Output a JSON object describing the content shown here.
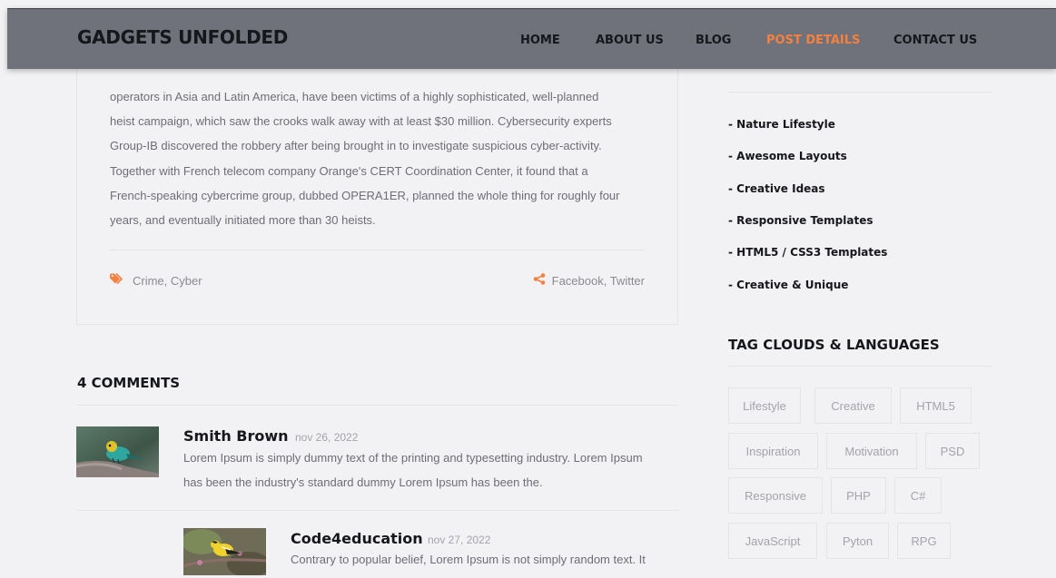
{
  "header": {
    "brand": "GADGETS UNFOLDED",
    "nav": [
      {
        "label": "HOME",
        "active": false
      },
      {
        "label": "ABOUT US",
        "active": false
      },
      {
        "label": "BLOG",
        "active": false
      },
      {
        "label": "POST DETAILS",
        "active": true
      },
      {
        "label": "CONTACT US",
        "active": false
      }
    ]
  },
  "post": {
    "lines": [
      "operators in Asia and Latin America, have been victims of a highly sophisticated, well-planned",
      "heist campaign, which saw the crooks walk away with at least $30 million. Cybersecurity experts",
      "Group-IB discovered the robbery after being brought in to investigate suspicious cyber-activity.",
      "Together with French telecom company Orange's CERT Coordination Center, it found that a",
      "French-speaking cybercrime group, dubbed OPERA1ER, planned the whole thing for roughly four",
      "years, and eventually initiated more than 30 heists."
    ],
    "tags": "Crime, Cyber",
    "tags_icon": "tag-icon",
    "share": "Facebook, Twitter",
    "share_icon": "share-icon"
  },
  "comments": {
    "title": "4 COMMENTS",
    "items": [
      {
        "name": "Smith Brown",
        "date": "nov 26, 2022",
        "text_lines": [
          "Lorem Ipsum is simply dummy text of the printing and typesetting industry. Lorem Ipsum",
          "has been the industry's standard dummy Lorem Ipsum has been the."
        ]
      },
      {
        "name": "Code4education",
        "date": "nov 27, 2022",
        "text_lines": [
          "Contrary to popular belief, Lorem Ipsum is not simply random text. It"
        ]
      }
    ]
  },
  "sidebar": {
    "categories": [
      "- Nature Lifestyle",
      "- Awesome Layouts",
      "- Creative Ideas",
      "- Responsive Templates",
      "- HTML5 / CSS3 Templates",
      "- Creative & Unique"
    ],
    "tags_title": "TAG CLOUDS & LANGUAGES",
    "tags": [
      "Lifestyle",
      "Creative",
      "HTML5",
      "Inspiration",
      "Motivation",
      "PSD",
      "Responsive",
      "PHP",
      "C#",
      "JavaScript",
      "Pyton",
      "RPG"
    ]
  },
  "colors": {
    "accent": "#f4813f",
    "header_bg": "#6f727a",
    "page_bg": "#f2f2f5",
    "heading": "#16171b"
  }
}
